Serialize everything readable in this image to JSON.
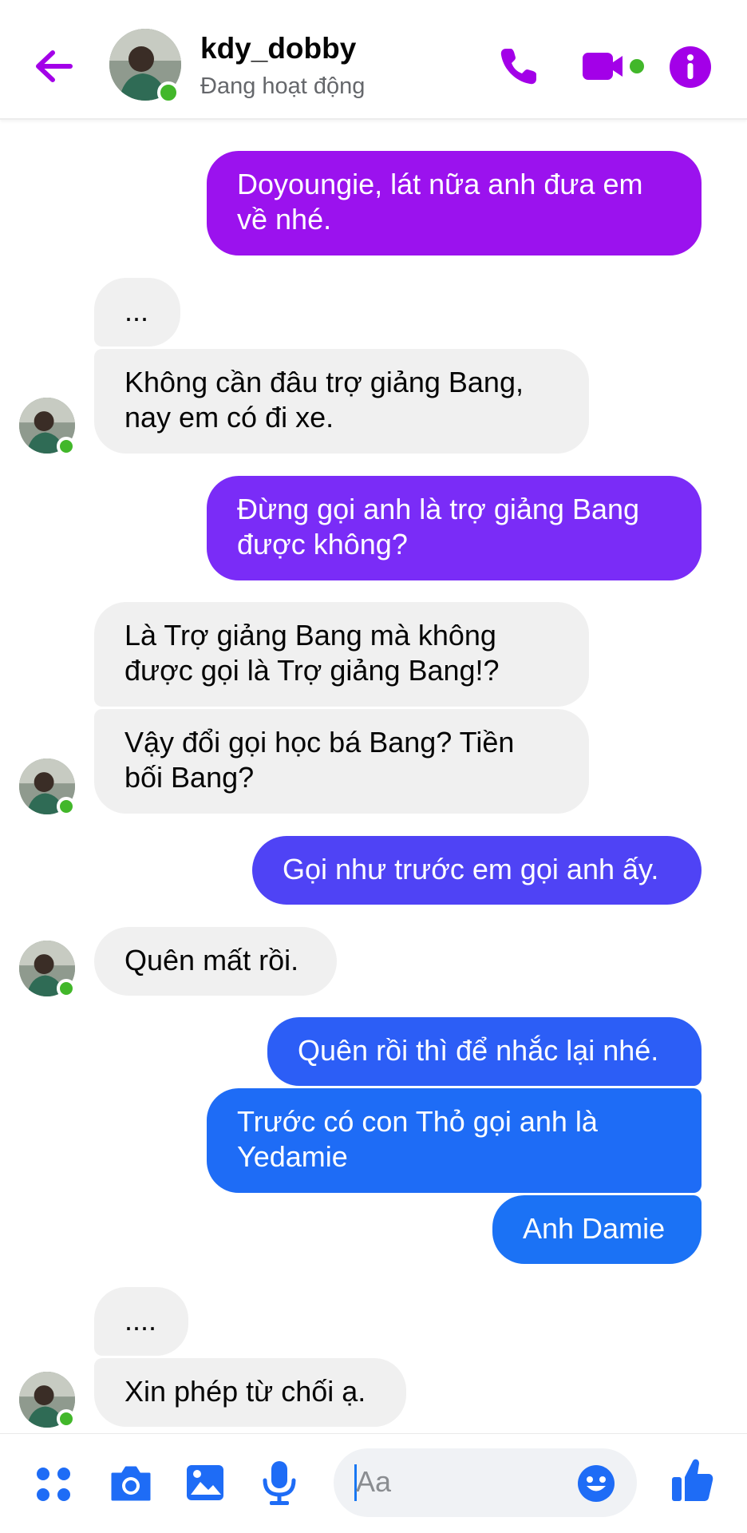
{
  "header": {
    "name": "kdy_dobby",
    "status": "Đang hoạt động"
  },
  "colors": {
    "accent": "#a300e8",
    "accent_blue": "#1e6cf6",
    "online": "#42b72a"
  },
  "messages": [
    {
      "side": "out",
      "text_1": "Doyoungie, lát nữa anh đưa em",
      "text_2": "về nhé."
    },
    {
      "side": "in",
      "text_1": "..."
    },
    {
      "side": "in",
      "text_1": "Không cần đâu trợ giảng Bang,",
      "text_2": "nay em có đi xe."
    },
    {
      "side": "out",
      "text_1": "Đừng gọi anh là trợ giảng Bang",
      "text_2": "được không?"
    },
    {
      "side": "in",
      "text_1": "Là Trợ giảng Bang mà không",
      "text_2": "được gọi là Trợ giảng Bang!?"
    },
    {
      "side": "in",
      "text_1": "Vậy đổi gọi học bá Bang? Tiền",
      "text_2": "bối Bang?"
    },
    {
      "side": "out",
      "text_1": "Gọi như trước em gọi anh ấy."
    },
    {
      "side": "in",
      "text_1": "Quên mất rồi."
    },
    {
      "side": "out",
      "text_1": "Quên rồi thì để nhắc lại nhé."
    },
    {
      "side": "out",
      "text_1": "Trước có con Thỏ gọi anh là",
      "text_2": "Yedamie"
    },
    {
      "side": "out",
      "text_1": "Anh Damie"
    },
    {
      "side": "in",
      "text_1": "...."
    },
    {
      "side": "in",
      "text_1": "Xin phép từ chối ạ."
    }
  ],
  "composer": {
    "placeholder": "Aa"
  }
}
